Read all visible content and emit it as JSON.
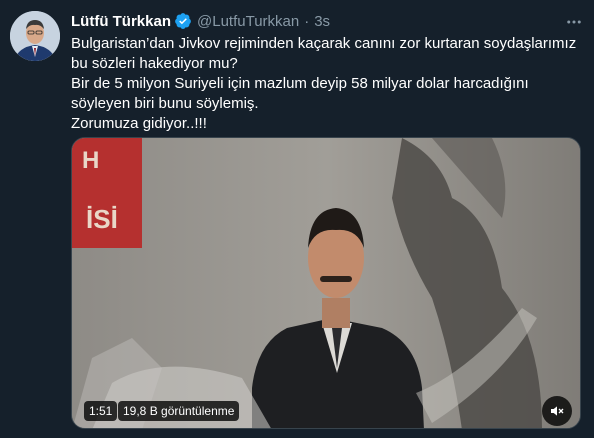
{
  "tweet": {
    "display_name": "Lütfü Türkkan",
    "verified_icon": "verified-badge-icon",
    "handle": "@LutfuTurkkan",
    "separator": "·",
    "timestamp": "3s",
    "more_icon": "more-options-icon",
    "text_lines": [
      "Bulgaristan’dan Jivkov rejiminden kaçarak canını zor kurtaran soydaşlarımız",
      "bu sözleri hakediyor mu?",
      "Bir de 5 milyon Suriyeli için mazlum deyip 58 milyar dolar harcadığını",
      "söyleyen biri bunu söylemiş.",
      "Zorumuza gidiyor..!!!"
    ]
  },
  "media": {
    "type": "video",
    "duration": "1:51",
    "views": "19,8 B görüntülenme",
    "volume_icon": "speaker-muted-icon",
    "background_sign_text": [
      "H",
      "İSİ"
    ]
  },
  "colors": {
    "background": "#15202b",
    "text_primary": "#ffffff",
    "text_secondary": "#8899a6",
    "verified": "#1da1f2"
  }
}
